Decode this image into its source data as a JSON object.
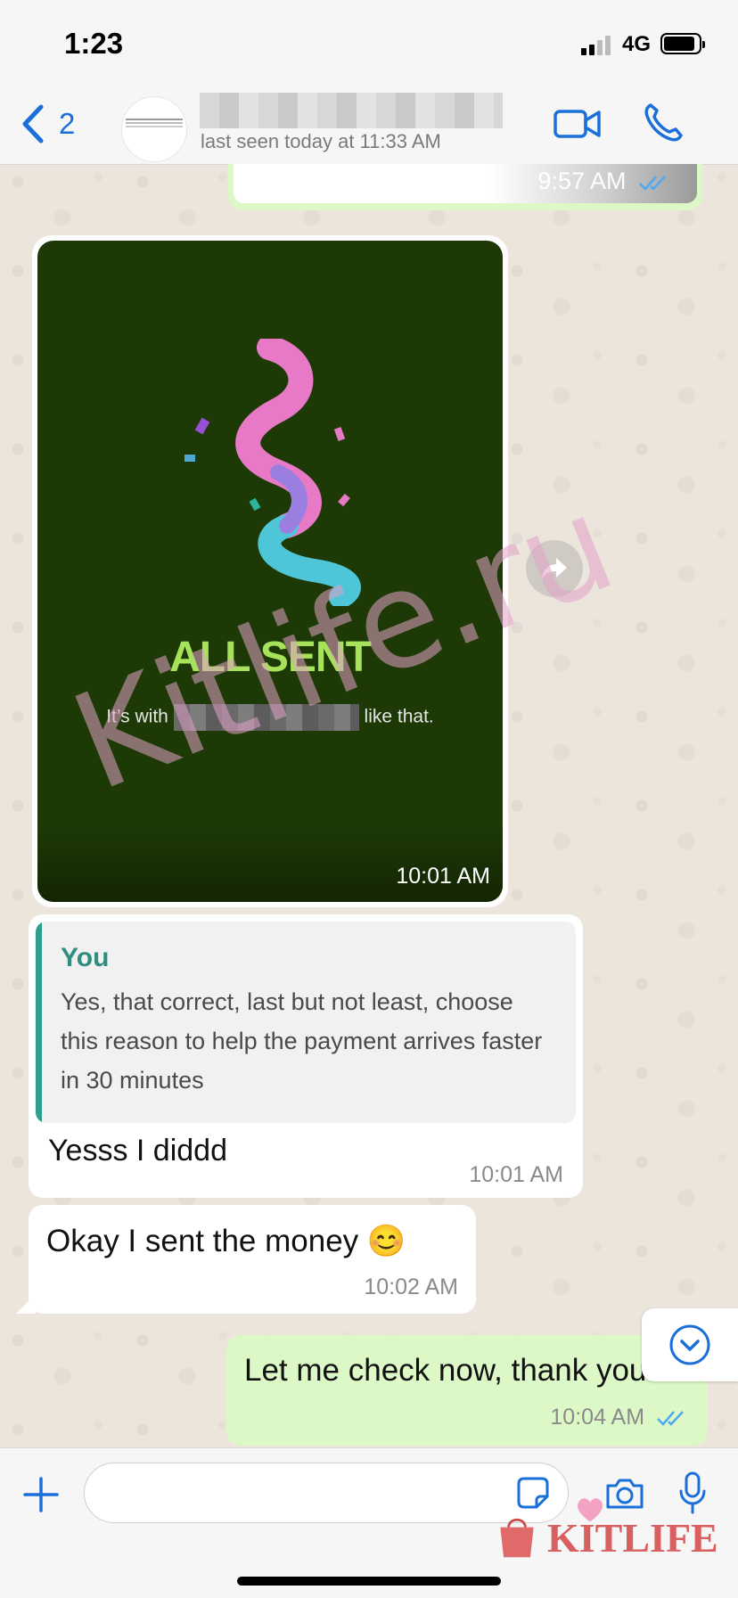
{
  "status_bar": {
    "time": "1:23",
    "network": "4G"
  },
  "header": {
    "back_count": "2",
    "last_seen": "last seen today at 11:33 AM"
  },
  "messages": {
    "top_partial": {
      "time": "9:57 AM"
    },
    "image_card": {
      "headline": "ALL SENT",
      "subline_start": "It’s with",
      "subline_end": "like that.",
      "time": "10:01 AM"
    },
    "reply": {
      "quote_author": "You",
      "quote_text": "Yes, that correct, last but not least, choose this reason to help the payment arrives faster in 30 minutes",
      "text": "Yesss I diddd",
      "time": "10:01 AM"
    },
    "okay": {
      "text": "Okay I sent the money 😊",
      "time": "10:02 AM"
    },
    "check": {
      "text": "Let me check now, thank you",
      "time": "10:04 AM"
    }
  },
  "watermark": "Kitlife.ru",
  "logo_watermark": "KITLIFE",
  "colors": {
    "accent": "#1b6fd9",
    "outgoing_bubble": "#dcf8c6",
    "incoming_bubble": "#ffffff",
    "quote_author": "#2e8f80",
    "card_background": "#1d3a06",
    "headline": "#a6e35b",
    "read_tick": "#4fa8f0"
  },
  "icons": [
    "chevron-left-icon",
    "video-camera-icon",
    "phone-icon",
    "forward-icon",
    "scroll-down-icon",
    "plus-icon",
    "sticker-icon",
    "camera-icon",
    "microphone-icon",
    "double-check-icon"
  ]
}
